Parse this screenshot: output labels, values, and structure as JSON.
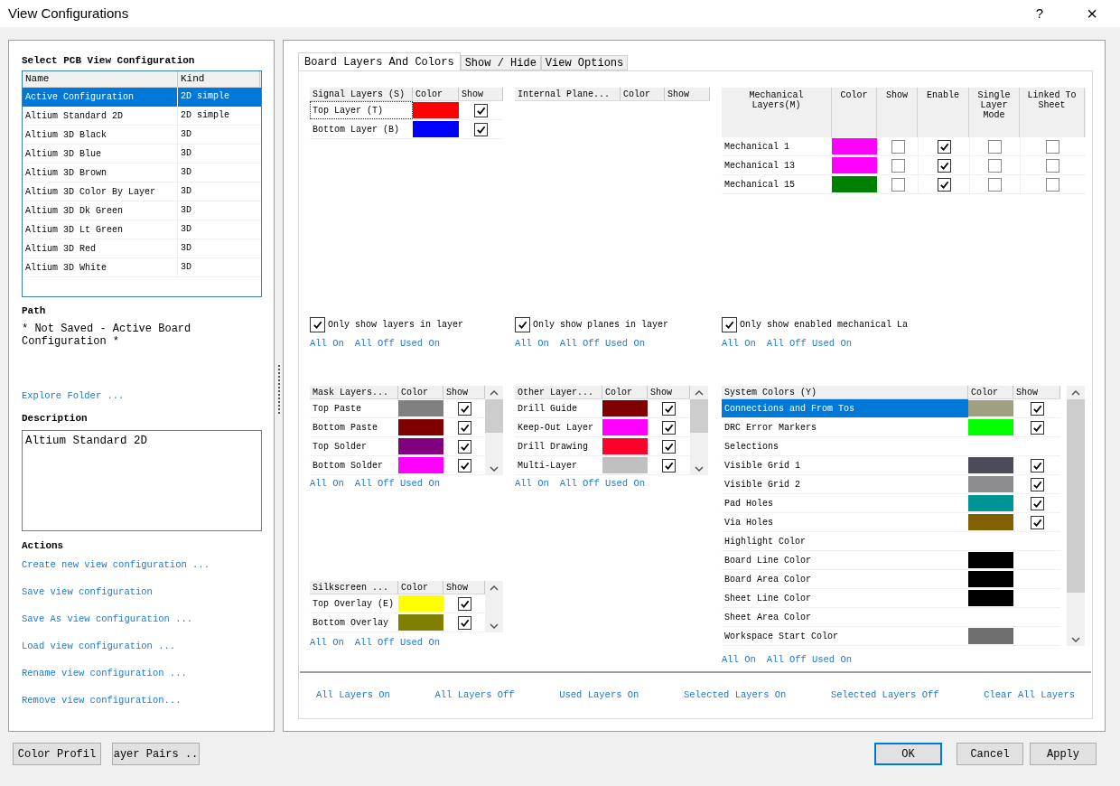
{
  "window": {
    "title": "View Configurations",
    "help": "?",
    "close": "×"
  },
  "config_list": {
    "heading": "Select PCB View Configuration",
    "columns": [
      "Name",
      "Kind"
    ],
    "rows": [
      {
        "name": "Active Configuration",
        "kind": "2D simple",
        "selected": true
      },
      {
        "name": "Altium Standard 2D",
        "kind": "2D simple",
        "selected": false
      },
      {
        "name": "Altium 3D Black",
        "kind": "3D",
        "selected": false
      },
      {
        "name": "Altium 3D Blue",
        "kind": "3D",
        "selected": false
      },
      {
        "name": "Altium 3D Brown",
        "kind": "3D",
        "selected": false
      },
      {
        "name": "Altium 3D Color By Layer",
        "kind": "3D",
        "selected": false
      },
      {
        "name": "Altium 3D Dk Green",
        "kind": "3D",
        "selected": false
      },
      {
        "name": "Altium 3D Lt Green",
        "kind": "3D",
        "selected": false
      },
      {
        "name": "Altium 3D Red",
        "kind": "3D",
        "selected": false
      },
      {
        "name": "Altium 3D White",
        "kind": "3D",
        "selected": false
      }
    ]
  },
  "path": {
    "label": "Path",
    "value": "* Not Saved - Active Board Configuration *"
  },
  "explore_link": "Explore Folder ...",
  "description": {
    "label": "Description",
    "value": "Altium Standard 2D"
  },
  "actions": {
    "label": "Actions",
    "links": [
      "Create new view configuration ...",
      "Save view configuration",
      "Save As view configuration ...",
      "Load view configuration ...",
      "Rename view configuration ...",
      "Remove view configuration..."
    ]
  },
  "left_buttons": [
    "Color Profil",
    "ayer Pairs .."
  ],
  "tabs": [
    {
      "label": "Board Layers And Colors",
      "selected": true
    },
    {
      "label": "Show / Hide",
      "selected": false
    },
    {
      "label": "View Options",
      "selected": false
    }
  ],
  "signal_layers": {
    "columns": [
      "Signal Layers (S)",
      "Color",
      "Show"
    ],
    "rows": [
      {
        "name": "Top Layer (T)",
        "color": "#ff0000",
        "show": true,
        "focused": true
      },
      {
        "name": "Bottom Layer (B)",
        "color": "#0000ff",
        "show": true,
        "focused": false
      }
    ],
    "only_show": {
      "label": "Only show layers in layer",
      "checked": true
    },
    "links": [
      "All On",
      "All Off",
      "Used On"
    ]
  },
  "internal_planes": {
    "columns": [
      "Internal Plane...",
      "Color",
      "Show"
    ],
    "only_show": {
      "label": "Only show planes in layer",
      "checked": true
    },
    "links": [
      "All On",
      "All Off",
      "Used On"
    ]
  },
  "mechanical_layers": {
    "columns": [
      "Mechanical Layers(M)",
      "Color",
      "Show",
      "Enable",
      "Single Layer Mode",
      "Linked To Sheet"
    ],
    "rows": [
      {
        "name": "Mechanical 1",
        "color": "#ff00ff",
        "show": false,
        "enable": true,
        "single_layer_mode": false,
        "linked_to_sheet": false
      },
      {
        "name": "Mechanical 13",
        "color": "#ff00ff",
        "show": false,
        "enable": true,
        "single_layer_mode": false,
        "linked_to_sheet": false
      },
      {
        "name": "Mechanical 15",
        "color": "#008000",
        "show": false,
        "enable": true,
        "single_layer_mode": false,
        "linked_to_sheet": false
      }
    ],
    "only_show": {
      "label": "Only show enabled mechanical La",
      "checked": true
    },
    "links": [
      "All On",
      "All Off",
      "Used On"
    ]
  },
  "mask_layers": {
    "columns": [
      "Mask Layers...",
      "Color",
      "Show"
    ],
    "rows": [
      {
        "name": "Top Paste",
        "color": "#808080",
        "show": true
      },
      {
        "name": "Bottom Paste",
        "color": "#800000",
        "show": true
      },
      {
        "name": "Top Solder",
        "color": "#800080",
        "show": true
      },
      {
        "name": "Bottom Solder",
        "color": "#ff00ff",
        "show": true
      }
    ],
    "links": [
      "All On",
      "All Off",
      "Used On"
    ]
  },
  "other_layers": {
    "columns": [
      "Other Layer...",
      "Color",
      "Show"
    ],
    "rows": [
      {
        "name": "Drill Guide",
        "color": "#800000",
        "show": true
      },
      {
        "name": "Keep-Out Layer",
        "color": "#ff00ff",
        "show": true
      },
      {
        "name": "Drill Drawing",
        "color": "#ff002a",
        "show": true
      },
      {
        "name": "Multi-Layer",
        "color": "#c0c0c0",
        "show": true
      }
    ],
    "links": [
      "All On",
      "All Off",
      "Used On"
    ]
  },
  "silkscreen_layers": {
    "columns": [
      "Silkscreen ...",
      "Color",
      "Show"
    ],
    "rows": [
      {
        "name": "Top Overlay (E)",
        "color": "#ffff00",
        "show": true
      },
      {
        "name": "Bottom Overlay",
        "color": "#808000",
        "show": true
      }
    ],
    "links": [
      "All On",
      "All Off",
      "Used On"
    ]
  },
  "system_colors": {
    "columns": [
      "System Colors (Y)",
      "Color",
      "Show"
    ],
    "rows": [
      {
        "name": "Connections and From Tos",
        "color": "#a0a080",
        "show": true,
        "selected": true
      },
      {
        "name": "DRC Error Markers",
        "color": "#00ff00",
        "show": true,
        "selected": false
      },
      {
        "name": "Selections",
        "selected": false
      },
      {
        "name": "Visible Grid 1",
        "color": "#4b4b5a",
        "show": true,
        "selected": false
      },
      {
        "name": "Visible Grid 2",
        "color": "#8c8c8f",
        "show": true,
        "selected": false
      },
      {
        "name": "Pad Holes",
        "color": "#009595",
        "show": true,
        "selected": false
      },
      {
        "name": "Via Holes",
        "color": "#806000",
        "show": true,
        "selected": false
      },
      {
        "name": "Highlight Color",
        "selected": false
      },
      {
        "name": "Board Line Color",
        "color": "#000000",
        "selected": false
      },
      {
        "name": "Board Area Color",
        "color": "#000000",
        "selected": false
      },
      {
        "name": "Sheet Line Color",
        "color": "#000000",
        "selected": false
      },
      {
        "name": "Sheet Area Color",
        "selected": false
      },
      {
        "name": "Workspace Start Color",
        "color": "#6e6e6e",
        "selected": false
      }
    ],
    "links": [
      "All On",
      "All Off",
      "Used On"
    ]
  },
  "bottom_links": [
    "All Layers On",
    "All Layers Off",
    "Used Layers On",
    "Selected Layers On",
    "Selected Layers Off",
    "Clear All Layers"
  ],
  "dialog_buttons": [
    {
      "label": "OK",
      "default": true
    },
    {
      "label": "Cancel",
      "default": false
    },
    {
      "label": "Apply",
      "default": false
    }
  ]
}
